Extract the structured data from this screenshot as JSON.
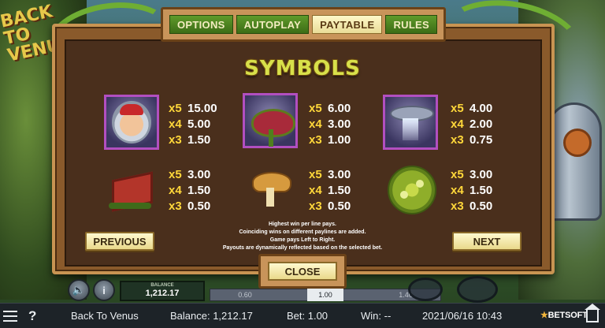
{
  "tabs": [
    {
      "label": "OPTIONS",
      "active": false
    },
    {
      "label": "AUTOPLAY",
      "active": false
    },
    {
      "label": "PAYTABLE",
      "active": true
    },
    {
      "label": "RULES",
      "active": false
    }
  ],
  "paytable": {
    "title": "SYMBOLS",
    "symbols": [
      {
        "icon": "astronaut-icon",
        "pays": [
          {
            "mult": "x5",
            "value": "15.00"
          },
          {
            "mult": "x4",
            "value": "5.00"
          },
          {
            "mult": "x3",
            "value": "1.50"
          }
        ]
      },
      {
        "icon": "carnivorous-plant-icon",
        "pays": [
          {
            "mult": "x5",
            "value": "6.00"
          },
          {
            "mult": "x4",
            "value": "3.00"
          },
          {
            "mult": "x3",
            "value": "1.00"
          }
        ]
      },
      {
        "icon": "ufo-icon",
        "pays": [
          {
            "mult": "x5",
            "value": "4.00"
          },
          {
            "mult": "x4",
            "value": "2.00"
          },
          {
            "mult": "x3",
            "value": "0.75"
          }
        ]
      },
      {
        "icon": "barn-icon",
        "pays": [
          {
            "mult": "x5",
            "value": "3.00"
          },
          {
            "mult": "x4",
            "value": "1.50"
          },
          {
            "mult": "x3",
            "value": "0.50"
          }
        ]
      },
      {
        "icon": "mushroom-icon",
        "pays": [
          {
            "mult": "x5",
            "value": "3.00"
          },
          {
            "mult": "x4",
            "value": "1.50"
          },
          {
            "mult": "x3",
            "value": "0.50"
          }
        ]
      },
      {
        "icon": "alien-cell-icon",
        "pays": [
          {
            "mult": "x5",
            "value": "3.00"
          },
          {
            "mult": "x4",
            "value": "1.50"
          },
          {
            "mult": "x3",
            "value": "0.50"
          }
        ]
      }
    ],
    "notes": [
      "Highest win per line pays.",
      "Coinciding wins on different paylines are added.",
      "Game pays Left to Right.",
      "Payouts are dynamically reflected based on the selected bet."
    ],
    "previous_label": "PREVIOUS",
    "next_label": "NEXT",
    "close_label": "CLOSE"
  },
  "controls": {
    "sound_icon": "speaker-icon",
    "info_icon": "info-icon",
    "info_glyph": "i",
    "balance_label": "BALANCE",
    "balance_value": "1,212.17",
    "bet_options": [
      "0.60",
      "1.00",
      "1.40"
    ],
    "bet_selected": "1.00"
  },
  "statusbar": {
    "menu_icon": "hamburger-menu-icon",
    "help_glyph": "?",
    "game_name": "Back To Venus",
    "balance": "Balance: 1,212.17",
    "bet": "Bet: 1.00",
    "win": "Win: --",
    "datetime": "2021/06/16 10:43",
    "logo_text": "BETSOFT",
    "home_icon": "home-icon"
  },
  "background": {
    "logo_text": "BACK TO VENUS"
  }
}
